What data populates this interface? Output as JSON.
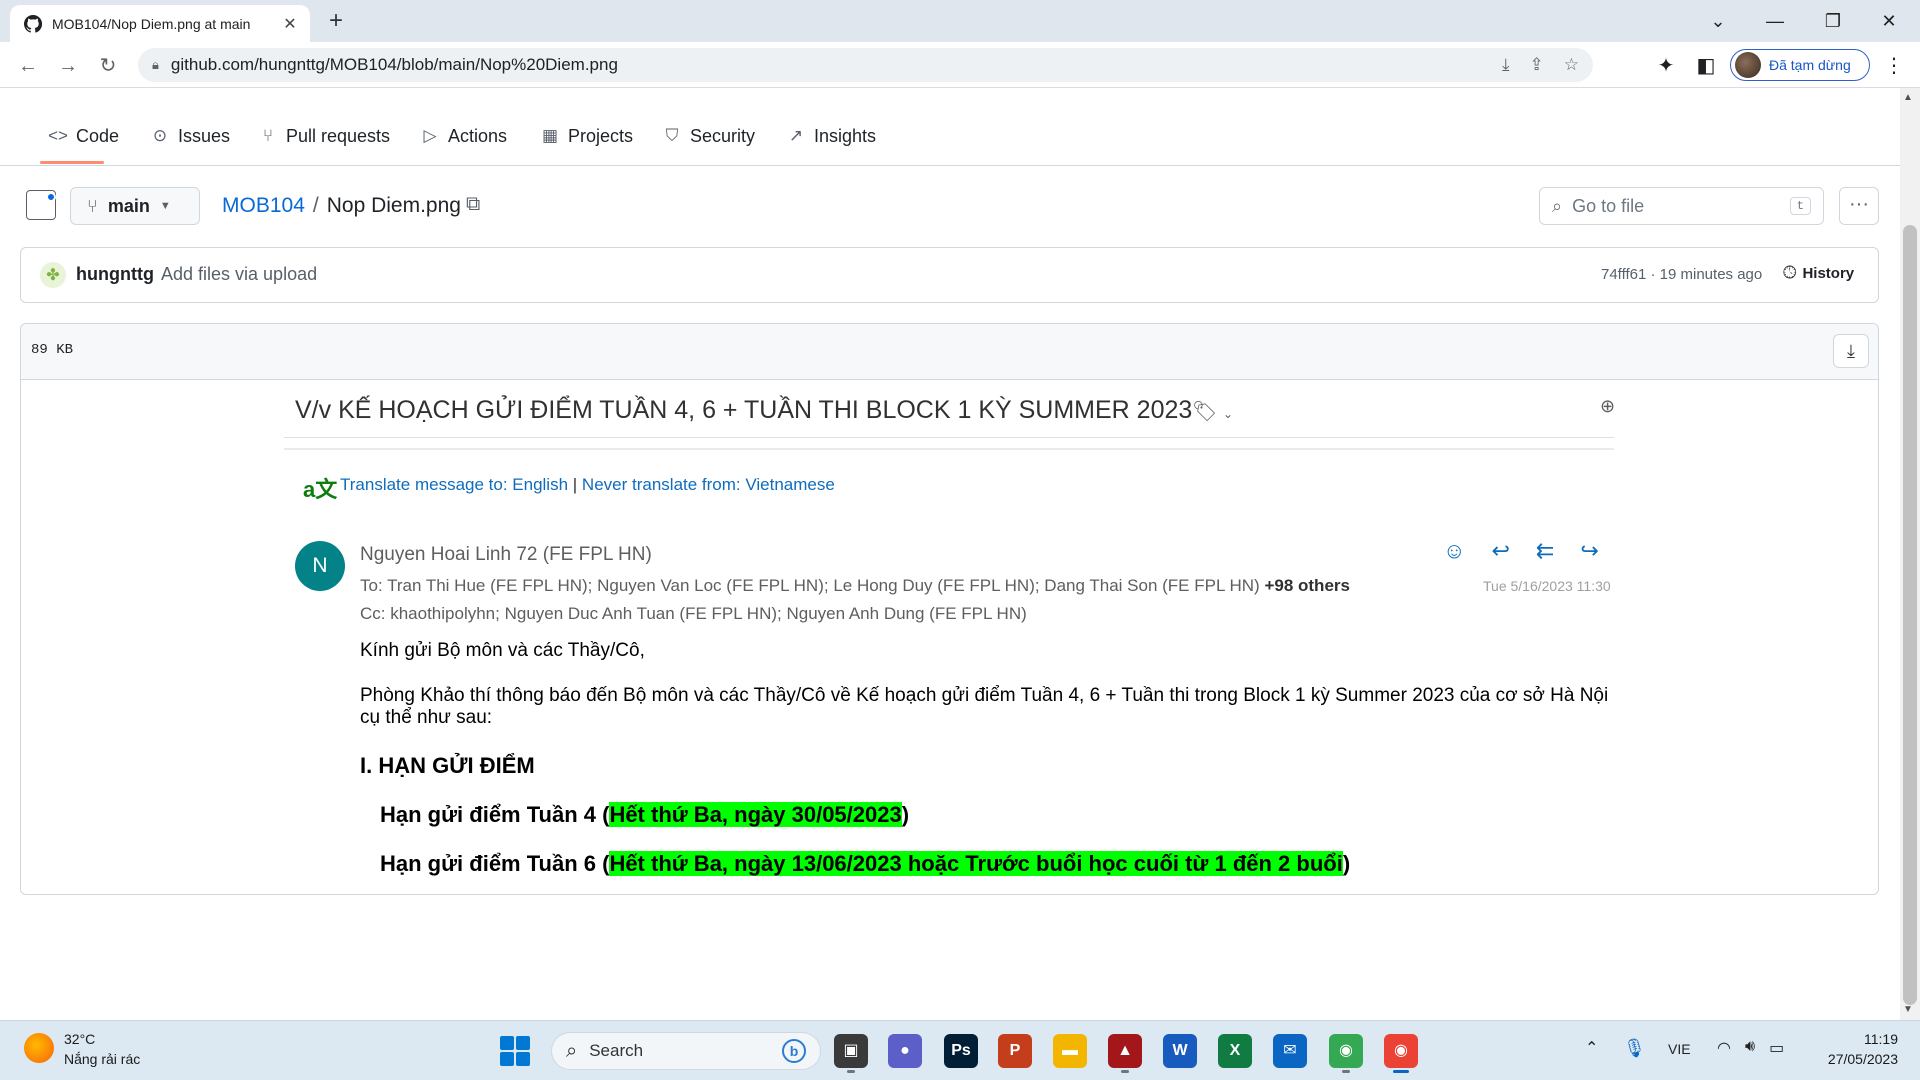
{
  "browser": {
    "tab_title": "MOB104/Nop Diem.png at main",
    "tab_close": "✕",
    "new_tab": "+",
    "url": "github.com/hungnttg/MOB104/blob/main/Nop%20Diem.png",
    "profile_label": "Đã tạm dừng",
    "window_controls": [
      "⌄",
      "—",
      "❐",
      "✕"
    ]
  },
  "repo_nav": {
    "items": [
      "Code",
      "Issues",
      "Pull requests",
      "Actions",
      "Projects",
      "Security",
      "Insights"
    ],
    "active": "Code"
  },
  "file_header": {
    "branch": "main",
    "repo": "MOB104",
    "separator": "/",
    "file": "Nop Diem.png",
    "go_to_file_placeholder": "Go to file",
    "go_to_file_shortcut": "t",
    "more": "···"
  },
  "commit": {
    "author": "hungnttg",
    "message": "Add files via upload",
    "meta": "74fff61 · 19 minutes ago",
    "history_label": "History"
  },
  "viewer": {
    "file_size": "89 KB"
  },
  "email": {
    "subject": "V/v KẾ HOẠCH GỬI ĐIỂM TUẦN 4, 6 + TUẦN THI BLOCK 1 KỲ SUMMER 2023",
    "translate_to": "Translate message to: English",
    "translate_sep": " | ",
    "never_translate": "Never translate from: Vietnamese",
    "avatar_letter": "N",
    "sender": "Nguyen Hoai Linh 72 (FE FPL HN)",
    "to_prefix": "To:  Tran Thi Hue (FE FPL HN);  Nguyen Van Loc (FE FPL HN);  Le Hong Duy (FE FPL HN);  Dang Thai Son (FE FPL HN) ",
    "to_others": " +98 others",
    "cc": "Cc:  khaothipolyhn;  Nguyen Duc Anh Tuan (FE FPL HN);  Nguyen Anh Dung (FE FPL HN)",
    "date": "Tue 5/16/2023 11:30",
    "greeting": "Kính gửi Bộ môn và các Thầy/Cô,",
    "notice": "Phòng Khảo thí thông báo đến Bộ môn và các Thầy/Cô về Kế hoạch gửi điểm Tuần 4, 6 + Tuần thi trong Block 1 kỳ Summer 2023 của cơ sở Hà Nội cụ thể như sau:",
    "section_title": "I. HẠN GỬI ĐIỂM",
    "deadline1_label": "Hạn gửi điểm Tuần 4 (",
    "deadline1_highlight": "Hết thứ Ba, ngày 30/05/2023",
    "deadline1_close": ")",
    "deadline2_label": "Hạn gửi điểm Tuần 6 (",
    "deadline2_highlight": "Hết thứ Ba, ngày 13/06/2023 hoặc Trước buổi học cuối từ 1 đến 2 buổi",
    "deadline2_close": ")",
    "highlight_color": "#00ff00"
  },
  "taskbar": {
    "weather_temp": "32°C",
    "weather_desc": "Nắng rải rác",
    "search_label": "Search",
    "bing": "b",
    "lang": "VIE",
    "time": "11:19",
    "date": "27/05/2023",
    "apps": [
      {
        "name": "task-view",
        "glyph": "▣",
        "color": "#3a3a3a"
      },
      {
        "name": "teams",
        "glyph": "●",
        "color": "#5b5fc7"
      },
      {
        "name": "photoshop",
        "glyph": "Ps",
        "color": "#001e36"
      },
      {
        "name": "powerpoint",
        "glyph": "P",
        "color": "#c43e1c"
      },
      {
        "name": "file-explorer",
        "glyph": "▬",
        "color": "#f2b600"
      },
      {
        "name": "app-red",
        "glyph": "▲",
        "color": "#a3161a"
      },
      {
        "name": "word",
        "glyph": "W",
        "color": "#185abd"
      },
      {
        "name": "excel",
        "glyph": "X",
        "color": "#107c41"
      },
      {
        "name": "mail",
        "glyph": "✉",
        "color": "#0a66c2"
      },
      {
        "name": "chrome-profile-1",
        "glyph": "◉",
        "color": "#34a853"
      },
      {
        "name": "chrome-profile-2",
        "glyph": "◉",
        "color": "#ea4335"
      }
    ]
  }
}
